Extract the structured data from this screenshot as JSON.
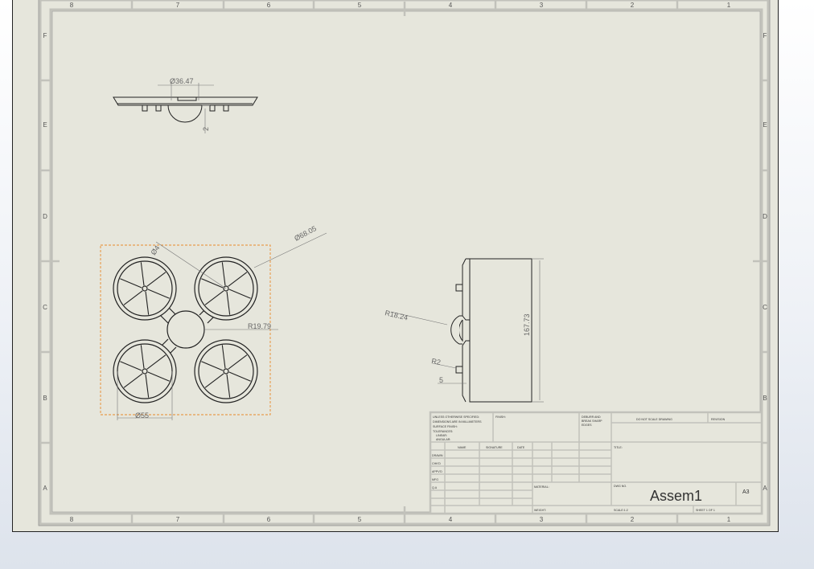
{
  "sheet": {
    "zones_columns": [
      "8",
      "7",
      "6",
      "5",
      "4",
      "3",
      "2",
      "1"
    ],
    "zones_rows": [
      "F",
      "E",
      "D",
      "C",
      "B",
      "A"
    ]
  },
  "dimensions": {
    "top_dia": "Ø36.47",
    "top_small": "2",
    "view_dia": "Ø68.05",
    "view_small_dia": "Ø4",
    "view_radius": "R19.79",
    "view_bottom_dia": "Ø55",
    "side_radius": "R18.24",
    "side_height": "167.73",
    "side_r2": "R2",
    "side_5": "5"
  },
  "title_block": {
    "notes": [
      "UNLESS OTHERWISE SPECIFIED:",
      "DIMENSIONS ARE IN MILLIMETERS",
      "SURFACE FINISH:",
      "TOLERANCES:",
      "LINEAR:",
      "ANGULAR:"
    ],
    "finish": "FINISH:",
    "deburr": [
      "DEBURR AND",
      "BREAK SHARP",
      "EDGES"
    ],
    "do_not_scale": "DO NOT SCALE DRAWING",
    "revision": "REVISION",
    "col_headers": [
      "NAME",
      "SIGNATURE",
      "DATE"
    ],
    "row_labels": [
      "DRAWN",
      "CHK'D",
      "APPV'D",
      "MFG",
      "Q.A"
    ],
    "title_label": "TITLE:",
    "material": "MATERIAL:",
    "weight": "WEIGHT:",
    "dwg_no_label": "DWG NO.",
    "drawing_title": "Assem1",
    "sheet_size": "A3",
    "scale": "SCALE:1:2",
    "sheet_no": "SHEET 1 OF 1"
  }
}
